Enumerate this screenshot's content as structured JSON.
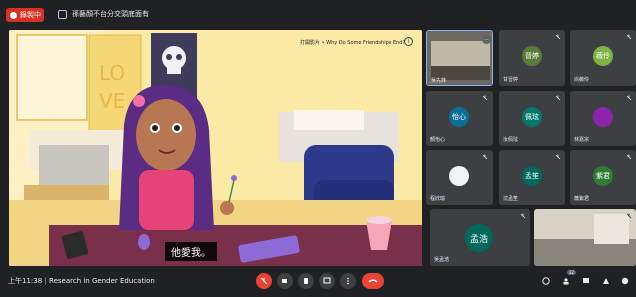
{
  "recording": {
    "label": "錄製中"
  },
  "meeting": {
    "title": "孫藝顏不台分交頭底面有"
  },
  "stage": {
    "video_title": "打開影片 • Why Do Some Friendships End?",
    "subtitle": "他愛我。"
  },
  "participants": [
    {
      "name": "吳先鋒",
      "initials": "",
      "avatar_color": "#5f6368"
    },
    {
      "name": "甘晉婷",
      "initials": "晉婷",
      "avatar_color": "#5d7a3a"
    },
    {
      "name": "尚薇伶",
      "initials": "薇伶",
      "avatar_color": "#7cb342"
    },
    {
      "name": "顏怡心",
      "initials": "怡心",
      "avatar_color": "#0b6e99"
    },
    {
      "name": "汝佩玹",
      "initials": "佩玹",
      "avatar_color": "#00796b"
    },
    {
      "name": "林嘉宗",
      "initials": "",
      "avatar_color": "#8e24aa"
    },
    {
      "name": "程欣瑜",
      "initials": "",
      "avatar_color": "#5f6368"
    },
    {
      "name": "沈孟笙",
      "initials": "孟笙",
      "avatar_color": "#00695c"
    },
    {
      "name": "蕭紫君",
      "initials": "紫君",
      "avatar_color": "#2e7d32"
    },
    {
      "name": "吳孟浩",
      "initials": "孟浩",
      "avatar_color": "#00695c"
    },
    {
      "name": "",
      "initials": "",
      "avatar_color": "#5f6368"
    }
  ],
  "bottom_bar": {
    "time": "上午11:38",
    "meeting_name": "Research in Gender Education",
    "participant_count": "32"
  }
}
